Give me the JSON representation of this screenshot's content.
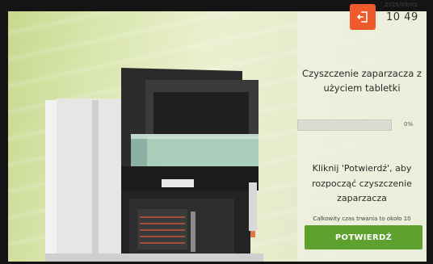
{
  "header": {
    "date": "2025/09/03",
    "time": "10 49",
    "exit_icon": "exit-icon",
    "exit_color": "#ee5a2a"
  },
  "panel": {
    "title": "Czyszczenie zaparzacza z użyciem tabletki",
    "progress_percent": 0,
    "progress_label": "0%",
    "instruction": "Kliknij 'Potwierdź', aby rozpocząć czyszczenie zaparzacza",
    "duration_text": "Całkowity czas trwania to około 10",
    "confirm_label": "POTWIERDŹ",
    "accent_color": "#5fa12e"
  },
  "illustration": {
    "icon": "coffee-machine-image"
  }
}
